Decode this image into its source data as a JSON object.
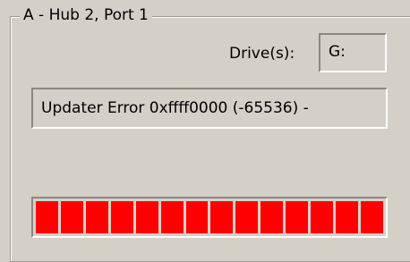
{
  "group": {
    "title": "A - Hub 2, Port 1"
  },
  "drive": {
    "label": "Drive(s):",
    "value": "G:"
  },
  "status": {
    "text": "Updater Error 0xffff0000 (-65536) -"
  },
  "progress": {
    "fraction": 1.0,
    "segments": 14,
    "color": "#ff0000"
  }
}
